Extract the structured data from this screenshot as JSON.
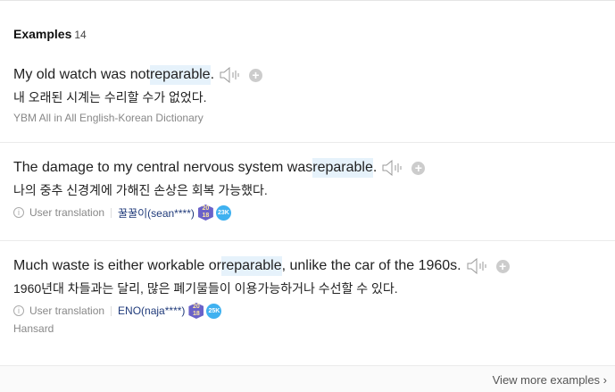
{
  "header": {
    "title": "Examples",
    "count": "14"
  },
  "examples": [
    {
      "pre": "My old watch was not ",
      "hl": "reparable",
      "post": ".",
      "ko": "내 오래된 시계는 수리할 수가 없었다.",
      "source": "YBM All in All English-Korean Dictionary"
    },
    {
      "pre": "The damage to my central nervous system was ",
      "hl": "reparable",
      "post": ".",
      "ko": "나의 중추 신경계에 가해진 손상은 회복 가능했다.",
      "meta": "User translation",
      "user": "꿀꿀이(sean****)",
      "badge_year": "20 18",
      "badge_count": "23K"
    },
    {
      "pre": "Much waste is either workable or ",
      "hl": "reparable",
      "post": ", unlike the car of the 1960s.",
      "ko": "1960년대 차들과는 달리, 많은 폐기물들이 이용가능하거나 수선할 수 있다.",
      "meta": "User translation",
      "user": "ENO(naja****)",
      "badge_year": "20 18",
      "badge_count": "25K",
      "source": "Hansard"
    }
  ],
  "footer": {
    "more": "View more examples ›"
  }
}
